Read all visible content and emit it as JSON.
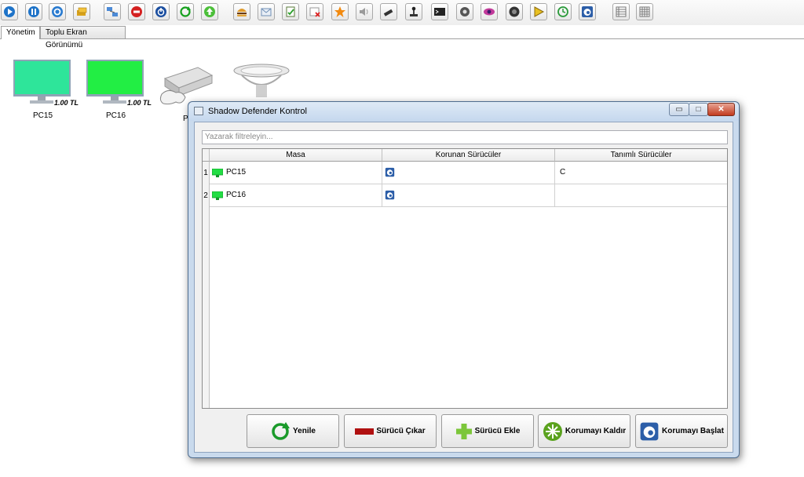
{
  "toolbar": {
    "icons": [
      "play-icon",
      "pause-icon",
      "refresh-icon",
      "money-icon",
      "network-icon",
      "power-off-icon",
      "shutdown-icon",
      "restart-icon",
      "upload-icon",
      "burger-icon",
      "message-icon",
      "edit-document-icon",
      "delete-icon",
      "star-icon",
      "volume-icon",
      "usb-icon",
      "joystick-icon",
      "terminal-icon",
      "settings-icon",
      "eye-icon",
      "camera-icon",
      "play-triangle-icon",
      "history-icon",
      "shadow-defender-icon",
      "list-view-icon",
      "grid-view-icon"
    ]
  },
  "tabs": [
    {
      "label": "Yönetim",
      "active": true
    },
    {
      "label": "Toplu Ekran Görünümü",
      "active": false
    }
  ],
  "stations": [
    {
      "name": "PC15",
      "price": "1.00 TL",
      "color": "#2ee59a"
    },
    {
      "name": "PC16",
      "price": "1.00 TL",
      "color": "#22ee44"
    },
    {
      "name": "P",
      "price": "",
      "color": ""
    }
  ],
  "dialog": {
    "title": "Shadow Defender Kontrol",
    "filter_placeholder": "Yazarak filtreleyin...",
    "columns": [
      "Masa",
      "Korunan Sürücüler",
      "Tanımlı Sürücüler"
    ],
    "rows": [
      {
        "num": "1",
        "masa": "PC15",
        "korunan_icon": "shadow-defender-icon",
        "tanimli": "C"
      },
      {
        "num": "2",
        "masa": "PC16",
        "korunan_icon": "shadow-defender-icon",
        "tanimli": ""
      }
    ],
    "buttons": {
      "refresh": "Yenile",
      "remove_drive": "Sürücü Çıkar",
      "add_drive": "Sürücü Ekle",
      "remove_protection": "Korumayı Kaldır",
      "start_protection": "Korumayı Başlat"
    }
  },
  "colors": {
    "pc_online": "#22ee44",
    "accent_blue": "#1a6fc4"
  }
}
